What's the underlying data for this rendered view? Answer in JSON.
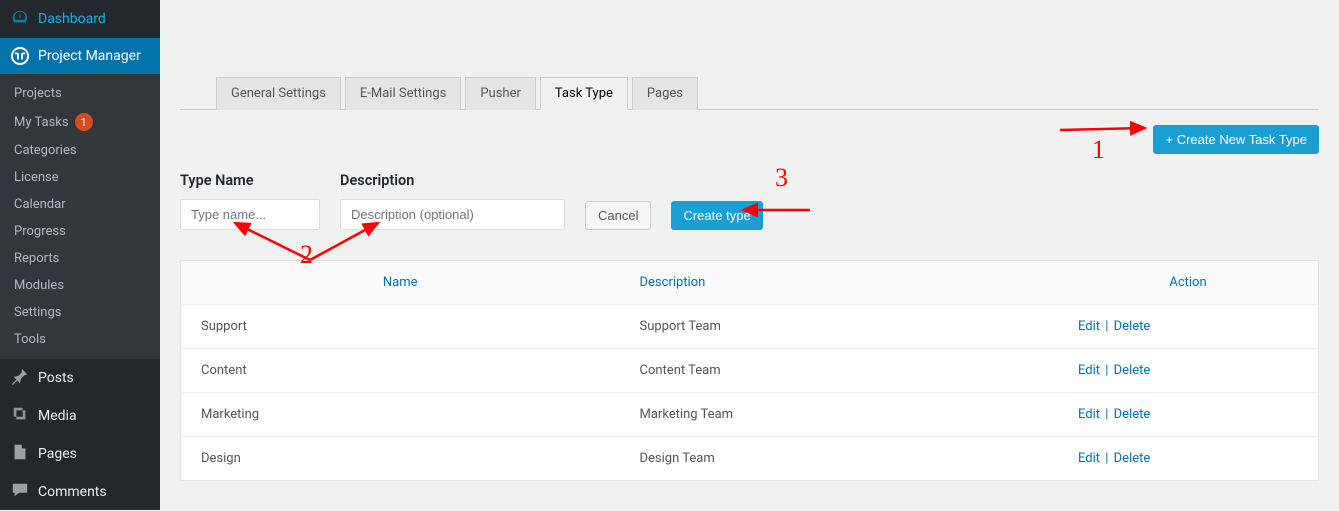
{
  "sidebar": {
    "dashboard": "Dashboard",
    "project_manager": "Project Manager",
    "sub": {
      "projects": "Projects",
      "my_tasks": "My Tasks",
      "my_tasks_badge": "1",
      "categories": "Categories",
      "license": "License",
      "calendar": "Calendar",
      "progress": "Progress",
      "reports": "Reports",
      "modules": "Modules",
      "settings": "Settings",
      "tools": "Tools"
    },
    "posts": "Posts",
    "media": "Media",
    "pages": "Pages",
    "comments": "Comments"
  },
  "tabs": {
    "general": "General Settings",
    "email": "E-Mail Settings",
    "pusher": "Pusher",
    "task_type": "Task Type",
    "pages": "Pages"
  },
  "buttons": {
    "create_new": "+ Create New Task Type",
    "cancel": "Cancel",
    "create_type": "Create type"
  },
  "form": {
    "type_name_label": "Type Name",
    "type_name_placeholder": "Type name...",
    "description_label": "Description",
    "description_placeholder": "Description (optional)"
  },
  "table": {
    "headers": {
      "name": "Name",
      "description": "Description",
      "action": "Action"
    },
    "edit": "Edit",
    "delete": "Delete",
    "rows": [
      {
        "name": "Support",
        "desc": "Support Team"
      },
      {
        "name": "Content",
        "desc": "Content Team"
      },
      {
        "name": "Marketing",
        "desc": "Marketing Team"
      },
      {
        "name": "Design",
        "desc": "Design Team"
      }
    ]
  },
  "annotations": {
    "n1": "1",
    "n2": "2",
    "n3": "3"
  }
}
